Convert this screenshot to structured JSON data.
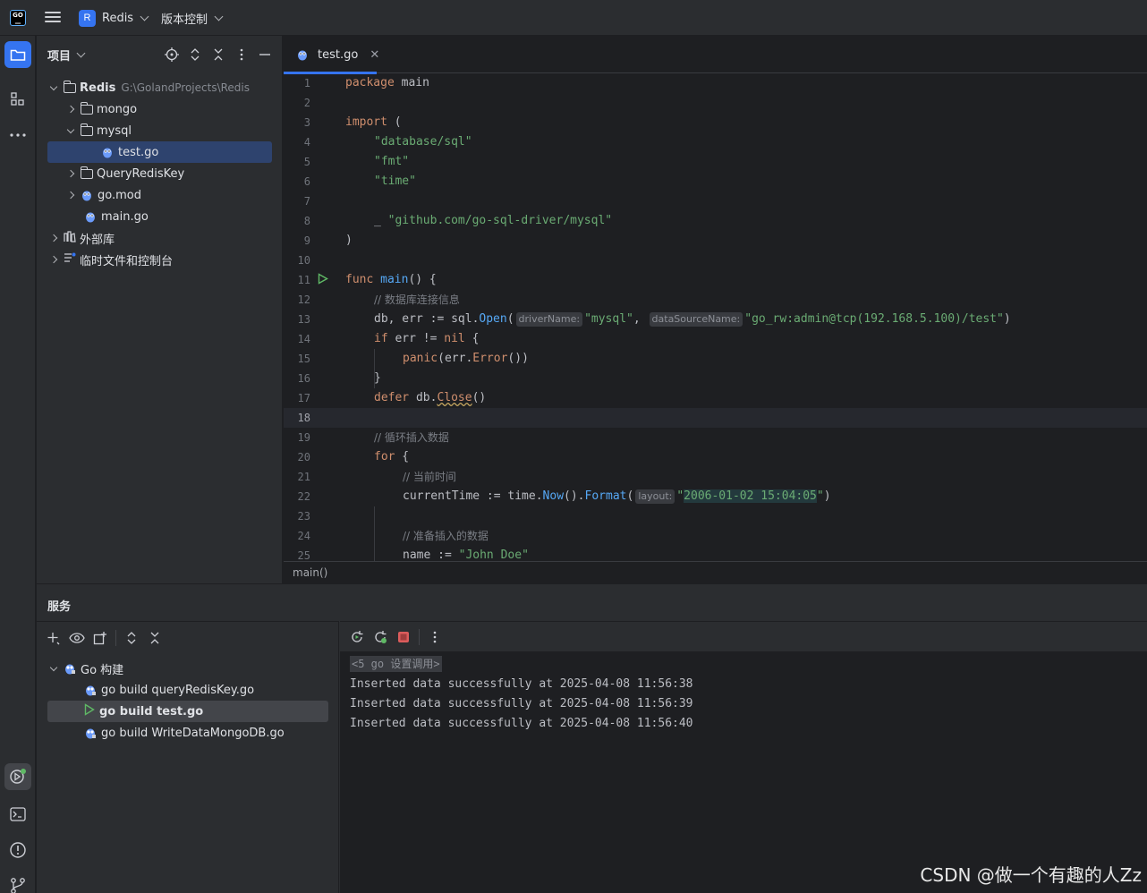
{
  "titlebar": {
    "logo_text": "GO",
    "project_badge": "R",
    "project_name": "Redis",
    "vcs_label": "版本控制"
  },
  "left_strip": {
    "icons": [
      "folder-icon",
      "structure-icon",
      "more-icon",
      "services-icon",
      "terminal-icon",
      "problems-icon",
      "git-icon"
    ]
  },
  "project_panel": {
    "title": "项目",
    "tree": [
      {
        "label": "Redis",
        "hint": "G:\\GolandProjects\\Redis",
        "type": "folder",
        "expanded": true
      },
      {
        "label": "mongo",
        "type": "folder",
        "expanded": false
      },
      {
        "label": "mysql",
        "type": "folder",
        "expanded": true
      },
      {
        "label": "test.go",
        "type": "gofile",
        "selected": true
      },
      {
        "label": "QueryRedisKey",
        "type": "folder",
        "expanded": false
      },
      {
        "label": "go.mod",
        "type": "gomod",
        "expanded": false
      },
      {
        "label": "main.go",
        "type": "gofile"
      },
      {
        "label": "外部库",
        "type": "library",
        "expanded": false
      },
      {
        "label": "临时文件和控制台",
        "type": "scratch",
        "expanded": false
      }
    ]
  },
  "editor": {
    "tab_label": "test.go",
    "current_line": 18,
    "line_numbers": [
      "1",
      "2",
      "3",
      "4",
      "5",
      "6",
      "7",
      "8",
      "9",
      "10",
      "11",
      "12",
      "13",
      "14",
      "15",
      "16",
      "17",
      "18",
      "19",
      "20",
      "21",
      "22",
      "23",
      "24",
      "25"
    ],
    "code": {
      "l1_kw": "package",
      "l1_name": " main",
      "l3_kw": "import",
      "l3_rest": " (",
      "l4": "\"database/sql\"",
      "l5": "\"fmt\"",
      "l6": "\"time\"",
      "l8_under": "_ ",
      "l8_str": "\"github.com/go-sql-driver/mysql\"",
      "l9": ")",
      "l11_kw": "func",
      "l11_fn": " main",
      "l11_rest": "() {",
      "l12": "// 数据库连接信息",
      "l13_a": "db, err := ",
      "l13_pkg": "sql",
      "l13_dot": ".",
      "l13_call": "Open",
      "l13_paren": "(",
      "l13_hint1": "driverName:",
      "l13_s1": "\"mysql\"",
      "l13_comma": ", ",
      "l13_hint2": "dataSourceName:",
      "l13_s2": "\"go_rw:admin@tcp(192.168.5.100)/test\"",
      "l13_end": ")",
      "l14_kw": "if",
      "l14_a": " err != ",
      "l14_nil": "nil",
      "l14_b": " {",
      "l15_call": "panic",
      "l15_a": "(err.",
      "l15_m": "Error",
      "l15_b": "())",
      "l16": "}",
      "l17_kw": "defer",
      "l17_a": " db.",
      "l17_m": "Close",
      "l17_b": "()",
      "l19": "// 循环插入数据",
      "l20_kw": "for",
      "l20_b": " {",
      "l21": "// 当前时间",
      "l22_a": "currentTime := ",
      "l22_pkg": "time",
      "l22_dot": ".",
      "l22_call": "Now",
      "l22_b": "().",
      "l22_m": "Format",
      "l22_p": "(",
      "l22_hint": "layout:",
      "l22_q1": "\"",
      "l22_hl": "2006-01-02 15:04:05",
      "l22_q2": "\"",
      "l22_end": ")",
      "l24": "// 准备插入的数据",
      "l25_a": "name := ",
      "l25_s": "\"John Doe\""
    },
    "breadcrumb": "main()"
  },
  "services": {
    "title": "服务",
    "tree": [
      {
        "label": "Go 构建"
      },
      {
        "label": "go build queryRedisKey.go"
      },
      {
        "label": "go build test.go",
        "selected": true
      },
      {
        "label": "go build WriteDataMongoDB.go"
      }
    ],
    "console": {
      "fold_header": "<5 go 设置调用>",
      "lines": [
        "Inserted data successfully at 2025-04-08 11:56:38",
        "Inserted data successfully at 2025-04-08 11:56:39",
        "Inserted data successfully at 2025-04-08 11:56:40"
      ]
    }
  },
  "watermark": "CSDN @做一个有趣的人Zz",
  "colors": {
    "accent": "#3574f0",
    "keyword": "#cf8e6d",
    "string": "#6aab73",
    "function": "#56a8f5",
    "comment": "#7a7e85",
    "selection": "#2e436e",
    "run_green": "#5fb865",
    "stop_red": "#db5c5c"
  }
}
